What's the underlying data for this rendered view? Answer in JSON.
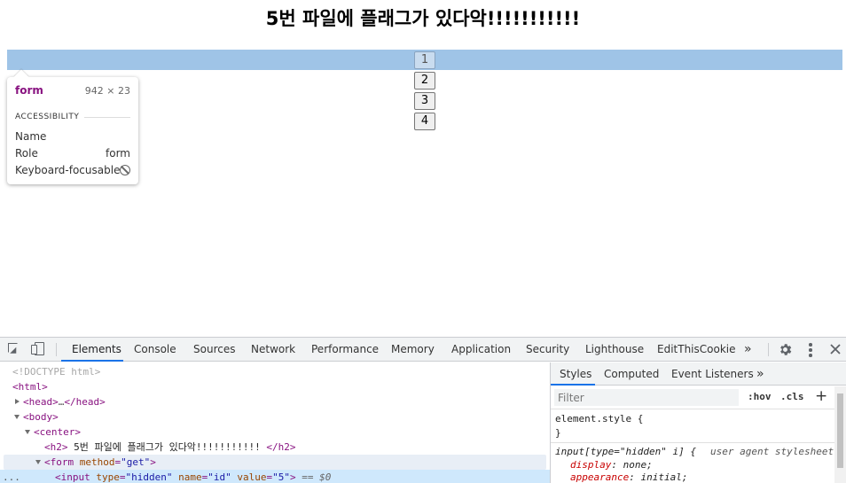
{
  "page": {
    "heading": "5번 파일에 플래그가 있다악!!!!!!!!!!!",
    "buttons": [
      "1",
      "2",
      "3",
      "4"
    ]
  },
  "tooltip": {
    "tag": "form",
    "size": "942 × 23",
    "section": "ACCESSIBILITY",
    "name_label": "Name",
    "role_label": "Role",
    "role_value": "form",
    "focus_label": "Keyboard-focusable"
  },
  "devtools": {
    "tabs": [
      "Elements",
      "Console",
      "Sources",
      "Network",
      "Performance",
      "Memory",
      "Application",
      "Security",
      "Lighthouse",
      "EditThisCookie"
    ],
    "more": "»",
    "dom": {
      "doctype": "<!DOCTYPE html>",
      "html_open": "<html>",
      "head_open": "<head>",
      "head_ellipsis": "…",
      "head_close": "</head>",
      "body_open": "<body>",
      "center_open": "<center>",
      "h2_open": "<h2>",
      "h2_text": " 5번 파일에 플래그가 있다악!!!!!!!!!!! ",
      "h2_close": "</h2>",
      "form_tag": "<form",
      "form_attr": "method",
      "form_val": "\"get\"",
      "form_end": ">",
      "input_tag": "<input",
      "input_attr1": "type",
      "input_val1": "\"hidden\"",
      "input_attr2": "name",
      "input_val2": "\"id\"",
      "input_attr3": "value",
      "input_val3": "\"5\"",
      "input_end": ">",
      "selected_ref": " == $0",
      "dots": "..."
    },
    "styles": {
      "tabs": [
        "Styles",
        "Computed",
        "Event Listeners"
      ],
      "more": "»",
      "filter_placeholder": "Filter",
      "hov": ":hov",
      "cls": ".cls",
      "plus": "+",
      "element_style": "element.style {",
      "close_brace": "}",
      "ua_selector": "input[type=\"hidden\" i] {",
      "ua_source": "user agent stylesheet",
      "prop1": "display",
      "val1": "none;",
      "prop2": "appearance",
      "val2": "initial;"
    }
  }
}
